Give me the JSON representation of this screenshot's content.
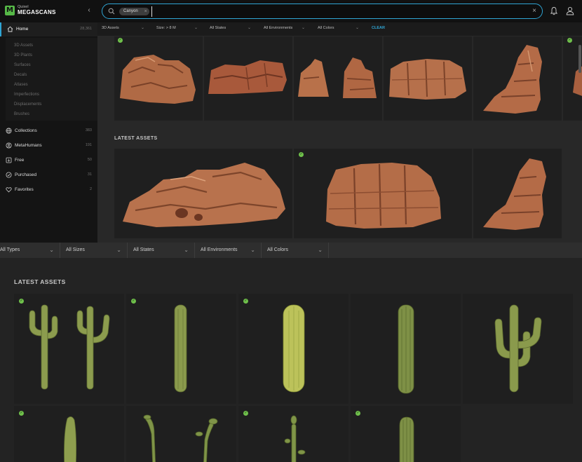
{
  "brand": {
    "line1": "Quixel",
    "line2": "MEGASCANS",
    "mark": "M"
  },
  "search": {
    "chip": "Canyon",
    "value": "",
    "placeholder": ""
  },
  "sidebar": {
    "items": [
      {
        "label": "Home",
        "count": "28,361"
      },
      {
        "label": "Collections",
        "count": "383"
      },
      {
        "label": "MetaHumans",
        "count": "191"
      },
      {
        "label": "Free",
        "count": "50"
      },
      {
        "label": "Purchased",
        "count": "31"
      },
      {
        "label": "Favorites",
        "count": "2"
      }
    ],
    "sub_items": [
      "3D Assets",
      "3D Plants",
      "Surfaces",
      "Decals",
      "Atlases",
      "Imperfections",
      "Displacements",
      "Brushes"
    ]
  },
  "upper_filters": [
    {
      "label": "3D Assets"
    },
    {
      "label": "Size: > 8 M"
    },
    {
      "label": "All States"
    },
    {
      "label": "All Environments"
    },
    {
      "label": "All Colors"
    }
  ],
  "upper_clear": "CLEAR",
  "upper_section_title": "LATEST ASSETS",
  "lower_filters": [
    {
      "label": "All Types"
    },
    {
      "label": "All Sizes"
    },
    {
      "label": "All States"
    },
    {
      "label": "All Environments"
    },
    {
      "label": "All Colors"
    }
  ],
  "lower_section_title": "LATEST ASSETS",
  "colors": {
    "accent": "#2fa5d4",
    "check": "#6fc04b",
    "rock": "#b86a45",
    "cactus": "#7f9448"
  }
}
